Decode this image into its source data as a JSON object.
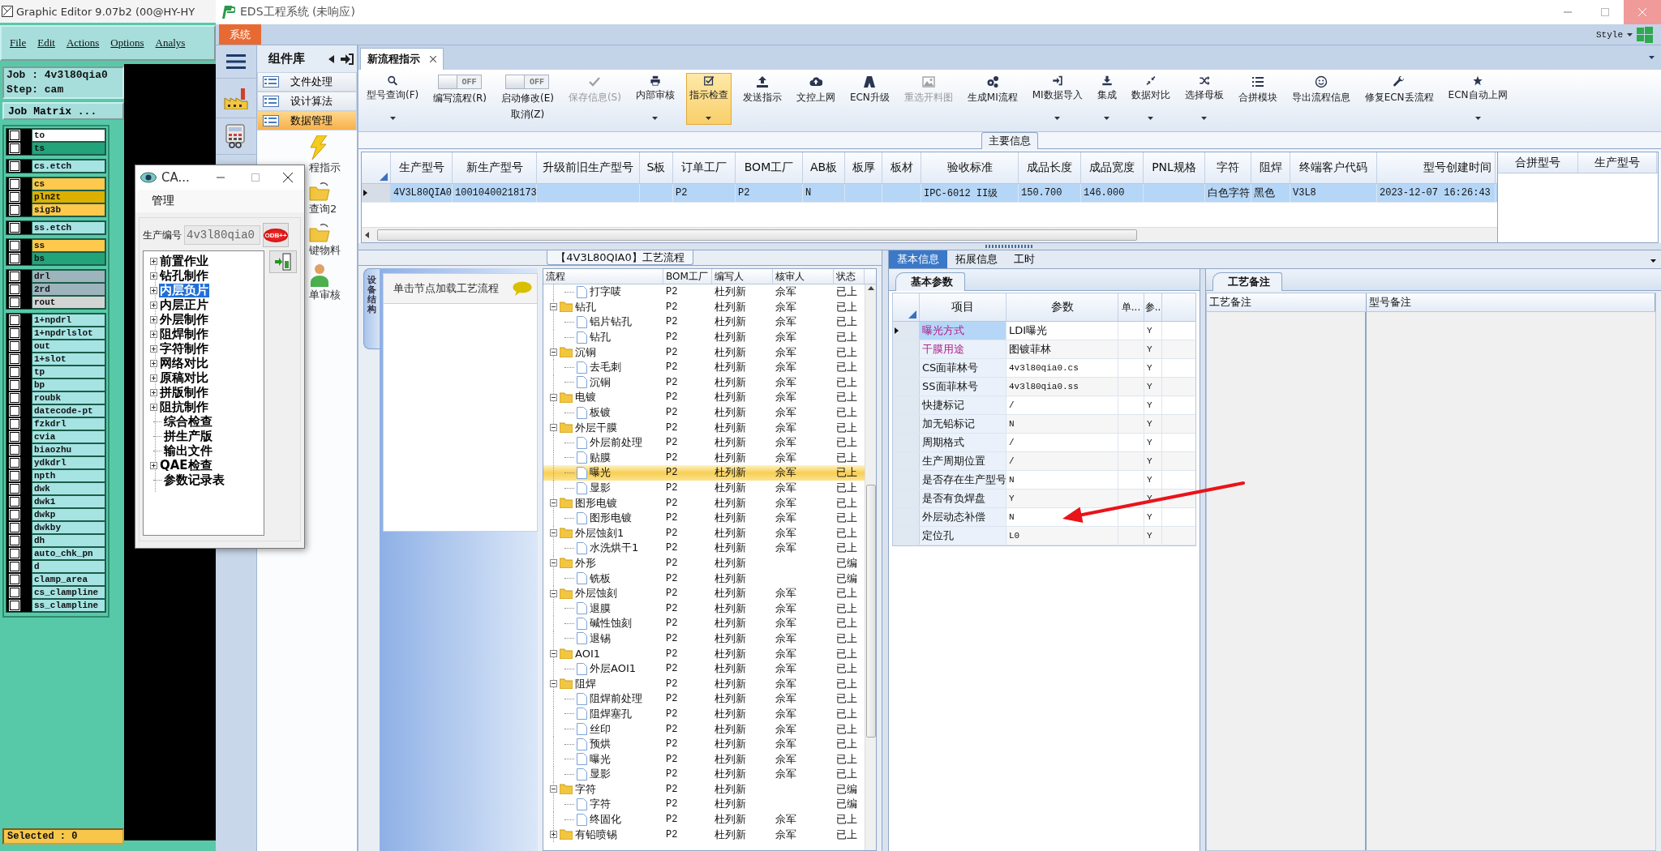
{
  "graphic_editor": {
    "title": "Graphic Editor 9.07b2 (00@HY-HY",
    "menu": [
      "File",
      "Edit",
      "Actions",
      "Options",
      "Analys"
    ],
    "job": "Job : 4v3l80qia0",
    "step": "Step: cam",
    "matrix_button": "Job Matrix ...",
    "layer_groups": [
      {
        "layers": [
          {
            "name": "to",
            "color": "#ffffff",
            "checked": false
          },
          {
            "name": "ts",
            "color": "#22a37a",
            "checked": false
          }
        ]
      },
      {
        "layers": [
          {
            "name": "cs.etch",
            "color": "#a6e3e3",
            "checked": false
          }
        ]
      },
      {
        "layers": [
          {
            "name": "cs",
            "color": "#ffc94d",
            "checked": false
          },
          {
            "name": "pln2t",
            "color": "#ddb000",
            "checked": false
          },
          {
            "name": "sig3b",
            "color": "#ffc94d",
            "checked": false
          }
        ]
      },
      {
        "layers": [
          {
            "name": "ss.etch",
            "color": "#a6e3e3",
            "checked": false
          }
        ]
      },
      {
        "layers": [
          {
            "name": "ss",
            "color": "#ffc94d",
            "checked": false
          },
          {
            "name": "bs",
            "color": "#22a37a",
            "checked": false
          }
        ]
      },
      {
        "layers": [
          {
            "name": "drl",
            "color": "#9db4bd",
            "checked": false
          },
          {
            "name": "2rd",
            "color": "#9db4bd",
            "checked": false
          },
          {
            "name": "rout",
            "color": "#d4d4d4",
            "checked": false
          }
        ]
      },
      {
        "layers": [
          {
            "name": "1+npdrl",
            "color": "#a6e3e3",
            "checked": false
          },
          {
            "name": "1+npdrlslot",
            "color": "#a6e3e3",
            "checked": false
          },
          {
            "name": "out",
            "color": "#a6e3e3",
            "checked": false
          },
          {
            "name": "1+slot",
            "color": "#a6e3e3",
            "checked": false
          },
          {
            "name": "tp",
            "color": "#a6e3e3",
            "checked": false
          },
          {
            "name": "bp",
            "color": "#a6e3e3",
            "checked": false
          },
          {
            "name": "roubk",
            "color": "#a6e3e3",
            "checked": false
          },
          {
            "name": "datecode-pt",
            "color": "#a6e3e3",
            "checked": false
          },
          {
            "name": "fzkdrl",
            "color": "#a6e3e3",
            "checked": false
          },
          {
            "name": "cvia",
            "color": "#a6e3e3",
            "checked": false
          },
          {
            "name": "biaozhu",
            "color": "#a6e3e3",
            "checked": false
          },
          {
            "name": "ydkdrl",
            "color": "#a6e3e3",
            "checked": false
          },
          {
            "name": "npth",
            "color": "#a6e3e3",
            "checked": false
          },
          {
            "name": "dwk",
            "color": "#a6e3e3",
            "checked": false
          },
          {
            "name": "dwk1",
            "color": "#a6e3e3",
            "checked": false
          },
          {
            "name": "dwkp",
            "color": "#a6e3e3",
            "checked": false
          },
          {
            "name": "dwkby",
            "color": "#a6e3e3",
            "checked": false
          },
          {
            "name": "dh",
            "color": "#a6e3e3",
            "checked": false
          },
          {
            "name": "auto_chk_pn",
            "color": "#a6e3e3",
            "checked": false
          },
          {
            "name": "d",
            "color": "#a6e3e3",
            "checked": false
          },
          {
            "name": "clamp_area",
            "color": "#a6e3e3",
            "checked": false
          },
          {
            "name": "cs_clampline",
            "color": "#a6e3e3",
            "checked": false
          },
          {
            "name": "ss_clampline",
            "color": "#a6e3e3",
            "checked": false
          }
        ]
      }
    ],
    "selected_count": "Selected : 0"
  },
  "eds": {
    "title": "EDS工程系统 (未响应)",
    "system_tab": "系统",
    "style_menu": "Style",
    "sidebar": {
      "title": "组件库",
      "items": [
        {
          "label": "文件处理",
          "selected": false
        },
        {
          "label": "设计算法",
          "selected": false
        },
        {
          "label": "数据管理",
          "selected": true
        }
      ],
      "tools": [
        {
          "label": "程指示",
          "kind": "lightning"
        },
        {
          "label": "查询2",
          "kind": "folder"
        },
        {
          "label": "键物料",
          "kind": "folder"
        },
        {
          "label": "单审核",
          "kind": "person"
        }
      ]
    },
    "doc_tabs": [
      {
        "label": "新流程指示",
        "selected": true
      }
    ],
    "ribbon": [
      {
        "kind": "button",
        "label": "型号查询(F)",
        "dropdown": true,
        "disabled": false,
        "active": false
      },
      {
        "kind": "toggle",
        "label": "编写流程(R)",
        "switch_text": "OFF",
        "on": false
      },
      {
        "kind": "toggle",
        "label": "启动修改(E)",
        "label2": "取消(Z)",
        "switch_text": "OFF",
        "on": false
      },
      {
        "kind": "button",
        "label": "保存信息(S)",
        "dropdown": false,
        "disabled": true,
        "active": false
      },
      {
        "kind": "button",
        "label": "内部审核",
        "dropdown": true,
        "disabled": false,
        "active": false
      },
      {
        "kind": "button",
        "label": "指示检查",
        "dropdown": true,
        "disabled": false,
        "active": true
      },
      {
        "kind": "button",
        "label": "发送指示",
        "dropdown": false,
        "disabled": false,
        "active": false
      },
      {
        "kind": "button",
        "label": "文控上网",
        "dropdown": false,
        "disabled": false,
        "active": false
      },
      {
        "kind": "button",
        "label": "ECN升级",
        "dropdown": false,
        "disabled": false,
        "active": false
      },
      {
        "kind": "button",
        "label": "重选开料图",
        "dropdown": false,
        "disabled": true,
        "active": false
      },
      {
        "kind": "button",
        "label": "生成MI流程",
        "dropdown": false,
        "disabled": false,
        "active": false
      },
      {
        "kind": "button",
        "label": "MI数据导入",
        "dropdown": true,
        "disabled": false,
        "active": false
      },
      {
        "kind": "button",
        "label": "集成",
        "dropdown": true,
        "disabled": false,
        "active": false
      },
      {
        "kind": "button",
        "label": "数据对比",
        "dropdown": true,
        "disabled": false,
        "active": false
      },
      {
        "kind": "button",
        "label": "选择母板",
        "dropdown": true,
        "disabled": false,
        "active": false
      },
      {
        "kind": "button",
        "label": "合拼模块",
        "dropdown": false,
        "disabled": false,
        "active": false
      },
      {
        "kind": "button",
        "label": "导出流程信息",
        "dropdown": false,
        "disabled": false,
        "active": false
      },
      {
        "kind": "button",
        "label": "修复ECN丢流程",
        "dropdown": false,
        "disabled": false,
        "active": false
      },
      {
        "kind": "button",
        "label": "ECN自动上网",
        "dropdown": true,
        "disabled": false,
        "active": false
      }
    ],
    "main_info": {
      "title": "主要信息",
      "columns": [
        "生产型号",
        "新生产型号",
        "升级前旧生产型号",
        "S板",
        "订单工厂",
        "BOM工厂",
        "AB板",
        "板厚",
        "板材",
        "验收标准",
        "成品长度",
        "成品宽度",
        "PNL规格",
        "字符",
        "阻焊",
        "终端客户代码",
        "型号创建时间"
      ],
      "rows": [
        {
          "selected": true,
          "cells": [
            "4V3L80QIA0",
            "10010400218173",
            null,
            null,
            "P2",
            "P2",
            "N",
            null,
            null,
            "IPC-6012 II级",
            "150.700",
            "146.000",
            null,
            "白色字符",
            "黑色",
            "V3L8",
            "2023-12-07 16:26:43"
          ]
        }
      ],
      "merge_columns": [
        "合拼型号",
        "生产型号"
      ]
    },
    "process": {
      "title": "【4V3L80QIA0】工艺流程",
      "side_tab": "设备结构",
      "hint": "单击节点加载工艺流程",
      "columns": [
        "流程",
        "BOM工厂",
        "编写人",
        "核审人",
        "状态"
      ],
      "continued": [
        {
          "label": "打字唛",
          "bom": "P2",
          "author": "杜列新",
          "reviewer": "佘军",
          "status": "已上",
          "selected": false
        }
      ],
      "nodes": [
        {
          "label": "钻孔",
          "bom": "P2",
          "author": "杜列新",
          "reviewer": "佘军",
          "status": "已上",
          "selected": false,
          "expanded": true,
          "children": [
            {
              "label": "铝片钻孔",
              "bom": "P2",
              "author": "杜列新",
              "reviewer": "佘军",
              "status": "已上",
              "selected": false
            },
            {
              "label": "钻孔",
              "bom": "P2",
              "author": "杜列新",
              "reviewer": "佘军",
              "status": "已上",
              "selected": false
            }
          ]
        },
        {
          "label": "沉铜",
          "bom": "P2",
          "author": "杜列新",
          "reviewer": "佘军",
          "status": "已上",
          "selected": false,
          "expanded": true,
          "children": [
            {
              "label": "去毛刺",
              "bom": "P2",
              "author": "杜列新",
              "reviewer": "佘军",
              "status": "已上",
              "selected": false
            },
            {
              "label": "沉铜",
              "bom": "P2",
              "author": "杜列新",
              "reviewer": "佘军",
              "status": "已上",
              "selected": false
            }
          ]
        },
        {
          "label": "电镀",
          "bom": "P2",
          "author": "杜列新",
          "reviewer": "佘军",
          "status": "已上",
          "selected": false,
          "expanded": true,
          "children": [
            {
              "label": "板镀",
              "bom": "P2",
              "author": "杜列新",
              "reviewer": "佘军",
              "status": "已上",
              "selected": false
            }
          ]
        },
        {
          "label": "外层干膜",
          "bom": "P2",
          "author": "杜列新",
          "reviewer": "佘军",
          "status": "已上",
          "selected": false,
          "expanded": true,
          "children": [
            {
              "label": "外层前处理",
              "bom": "P2",
              "author": "杜列新",
              "reviewer": "佘军",
              "status": "已上",
              "selected": false
            },
            {
              "label": "贴膜",
              "bom": "P2",
              "author": "杜列新",
              "reviewer": "佘军",
              "status": "已上",
              "selected": false
            },
            {
              "label": "曝光",
              "bom": "P2",
              "author": "杜列新",
              "reviewer": "佘军",
              "status": "已上",
              "selected": true
            },
            {
              "label": "显影",
              "bom": "P2",
              "author": "杜列新",
              "reviewer": "佘军",
              "status": "已上",
              "selected": false
            }
          ]
        },
        {
          "label": "图形电镀",
          "bom": "P2",
          "author": "杜列新",
          "reviewer": "佘军",
          "status": "已上",
          "selected": false,
          "expanded": true,
          "children": [
            {
              "label": "图形电镀",
              "bom": "P2",
              "author": "杜列新",
              "reviewer": "佘军",
              "status": "已上",
              "selected": false
            }
          ]
        },
        {
          "label": "外层蚀刻1",
          "bom": "P2",
          "author": "杜列新",
          "reviewer": "佘军",
          "status": "已上",
          "selected": false,
          "expanded": true,
          "children": [
            {
              "label": "水洗烘干1",
              "bom": "P2",
              "author": "杜列新",
              "reviewer": "佘军",
              "status": "已上",
              "selected": false
            }
          ]
        },
        {
          "label": "外形",
          "bom": "P2",
          "author": "杜列新",
          "status": "已编",
          "selected": false,
          "expanded": true,
          "children": [
            {
              "label": "铣板",
              "bom": "P2",
              "author": "杜列新",
              "status": "已编",
              "selected": false
            }
          ]
        },
        {
          "label": "外层蚀刻",
          "bom": "P2",
          "author": "杜列新",
          "reviewer": "佘军",
          "status": "已上",
          "selected": false,
          "expanded": true,
          "children": [
            {
              "label": "退膜",
              "bom": "P2",
              "author": "杜列新",
              "reviewer": "佘军",
              "status": "已上",
              "selected": false
            },
            {
              "label": "碱性蚀刻",
              "bom": "P2",
              "author": "杜列新",
              "reviewer": "佘军",
              "status": "已上",
              "selected": false
            },
            {
              "label": "退锡",
              "bom": "P2",
              "author": "杜列新",
              "reviewer": "佘军",
              "status": "已上",
              "selected": false
            }
          ]
        },
        {
          "label": "AOI1",
          "bom": "P2",
          "author": "杜列新",
          "reviewer": "佘军",
          "status": "已上",
          "selected": false,
          "expanded": true,
          "children": [
            {
              "label": "外层AOI1",
              "bom": "P2",
              "author": "杜列新",
              "reviewer": "佘军",
              "status": "已上",
              "selected": false
            }
          ]
        },
        {
          "label": "阻焊",
          "bom": "P2",
          "author": "杜列新",
          "reviewer": "佘军",
          "status": "已上",
          "selected": false,
          "expanded": true,
          "children": [
            {
              "label": "阻焊前处理",
              "bom": "P2",
              "author": "杜列新",
              "reviewer": "佘军",
              "status": "已上",
              "selected": false
            },
            {
              "label": "阻焊塞孔",
              "bom": "P2",
              "author": "杜列新",
              "reviewer": "佘军",
              "status": "已上",
              "selected": false
            },
            {
              "label": "丝印",
              "bom": "P2",
              "author": "杜列新",
              "reviewer": "佘军",
              "status": "已上",
              "selected": false
            },
            {
              "label": "预烘",
              "bom": "P2",
              "author": "杜列新",
              "reviewer": "佘军",
              "status": "已上",
              "selected": false
            },
            {
              "label": "曝光",
              "bom": "P2",
              "author": "杜列新",
              "reviewer": "佘军",
              "status": "已上",
              "selected": false
            },
            {
              "label": "显影",
              "bom": "P2",
              "author": "杜列新",
              "reviewer": "佘军",
              "status": "已上",
              "selected": false
            }
          ]
        },
        {
          "label": "字符",
          "bom": "P2",
          "author": "杜列新",
          "status": "已编",
          "selected": false,
          "expanded": true,
          "children": [
            {
              "label": "字符",
              "bom": "P2",
              "author": "杜列新",
              "status": "已编",
              "selected": false
            },
            {
              "label": "终固化",
              "bom": "P2",
              "author": "杜列新",
              "reviewer": "佘军",
              "status": "已上",
              "selected": false
            }
          ]
        },
        {
          "label": "有铅喷锡",
          "bom": "P2",
          "author": "杜列新",
          "reviewer": "佘军",
          "status": "已上",
          "selected": false,
          "expanded": false
        }
      ]
    },
    "detail": {
      "tabs": [
        {
          "label": "基本信息",
          "selected": true
        },
        {
          "label": "拓展信息",
          "selected": false
        },
        {
          "label": "工时",
          "selected": false
        }
      ],
      "params_tab": "基本参数",
      "param_columns": [
        "项目",
        "参数",
        "单...",
        "参.."
      ],
      "params": [
        {
          "item": "曝光方式",
          "value": "LDI曝光",
          "flag": "Y",
          "emphasized": true,
          "selected": true
        },
        {
          "item": "干膜用途",
          "value": "图镀菲林",
          "flag": "Y",
          "emphasized": true,
          "selected": false
        },
        {
          "item": "CS面菲林号",
          "value": "4v3l80qia0.cs",
          "flag": "Y",
          "emphasized": false,
          "selected": false
        },
        {
          "item": "SS面菲林号",
          "value": "4v3l80qia0.ss",
          "flag": "Y",
          "emphasized": false,
          "selected": false
        },
        {
          "item": "快捷标记",
          "value": "/",
          "flag": "Y",
          "emphasized": false,
          "selected": false
        },
        {
          "item": "加无铅标记",
          "value": "N",
          "flag": "Y",
          "emphasized": false,
          "selected": false
        },
        {
          "item": "周期格式",
          "value": "/",
          "flag": "Y",
          "emphasized": false,
          "selected": false
        },
        {
          "item": "生产周期位置",
          "value": "/",
          "flag": "Y",
          "emphasized": false,
          "selected": false
        },
        {
          "item": "是否存在生产型号",
          "value": "N",
          "flag": "Y",
          "emphasized": false,
          "selected": false
        },
        {
          "item": "是否有负焊盘",
          "value": "Y",
          "flag": "Y",
          "emphasized": false,
          "selected": false
        },
        {
          "item": "外层动态补偿",
          "value": "N",
          "flag": "Y",
          "emphasized": false,
          "selected": false
        },
        {
          "item": "定位孔",
          "value": "L0",
          "flag": "Y",
          "emphasized": false,
          "selected": false
        }
      ],
      "notes_tab": "工艺备注",
      "notes_columns": [
        "工艺备注",
        "型号备注"
      ]
    }
  },
  "dialog": {
    "title": "CA...",
    "menu": "管理",
    "field_label": "生产编号",
    "field_value": "4v3l80qia0",
    "odb_button": "ODB++",
    "items": [
      {
        "label": "前置作业",
        "kind": "branch",
        "selected": false
      },
      {
        "label": "钻孔制作",
        "kind": "branch",
        "selected": false
      },
      {
        "label": "内层负片",
        "kind": "branch",
        "selected": true
      },
      {
        "label": "内层正片",
        "kind": "branch",
        "selected": false
      },
      {
        "label": "外层制作",
        "kind": "branch",
        "selected": false
      },
      {
        "label": "阻焊制作",
        "kind": "branch",
        "selected": false
      },
      {
        "label": "字符制作",
        "kind": "branch",
        "selected": false
      },
      {
        "label": "网络对比",
        "kind": "branch",
        "selected": false
      },
      {
        "label": "原稿对比",
        "kind": "branch",
        "selected": false
      },
      {
        "label": "拼版制作",
        "kind": "branch",
        "selected": false
      },
      {
        "label": "阻抗制作",
        "kind": "branch",
        "selected": false
      },
      {
        "label": "综合检查",
        "kind": "leaf",
        "selected": false
      },
      {
        "label": "拼生产版",
        "kind": "leaf",
        "selected": false
      },
      {
        "label": "输出文件",
        "kind": "leaf",
        "selected": false
      },
      {
        "label": "QAE检查",
        "kind": "branch",
        "selected": false
      },
      {
        "label": "参数记录表",
        "kind": "leaf",
        "selected": false
      }
    ]
  }
}
